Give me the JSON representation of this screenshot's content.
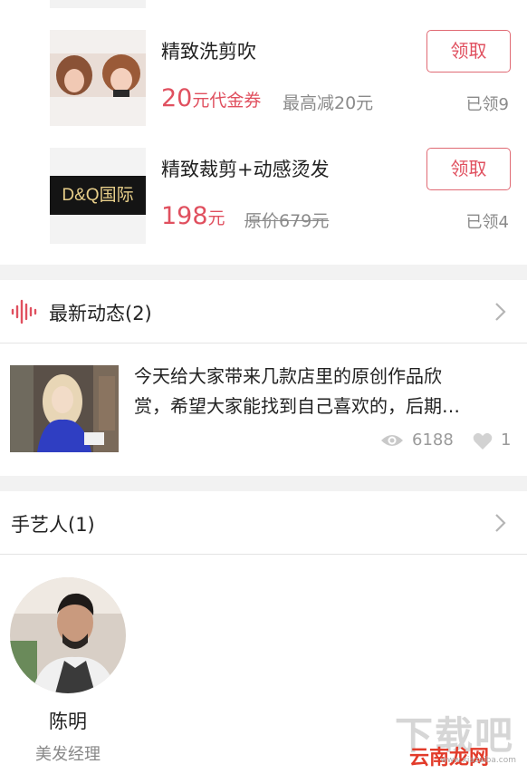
{
  "coupons": [
    {
      "name": "精致洗剪吹",
      "price_num": "20",
      "price_unit": "元代金券",
      "sub": "最高减20元",
      "claim_label": "领取",
      "claimed": "已领9"
    },
    {
      "name": "精致裁剪+动感烫发",
      "price_num": "198",
      "price_unit": "元",
      "sub": "原价679元",
      "claim_label": "领取",
      "claimed": "已领4",
      "logo_text": "D&Q国际"
    }
  ],
  "news_section": {
    "title": "最新动态(2)",
    "line1": "今天给大家带来几款店里的原创作品欣",
    "line2": "赏，希望大家能找到自己喜欢的，后期…",
    "views": "6188",
    "likes": "1"
  },
  "artisan_section": {
    "title": "手艺人(1)",
    "name": "陈明",
    "role": "美发经理"
  },
  "watermark": {
    "big": "下载吧",
    "cn": "云南龙网",
    "url": "www.xiazaiba.com"
  },
  "colors": {
    "accent": "#e0505f",
    "gap": "#f2f2f2"
  }
}
